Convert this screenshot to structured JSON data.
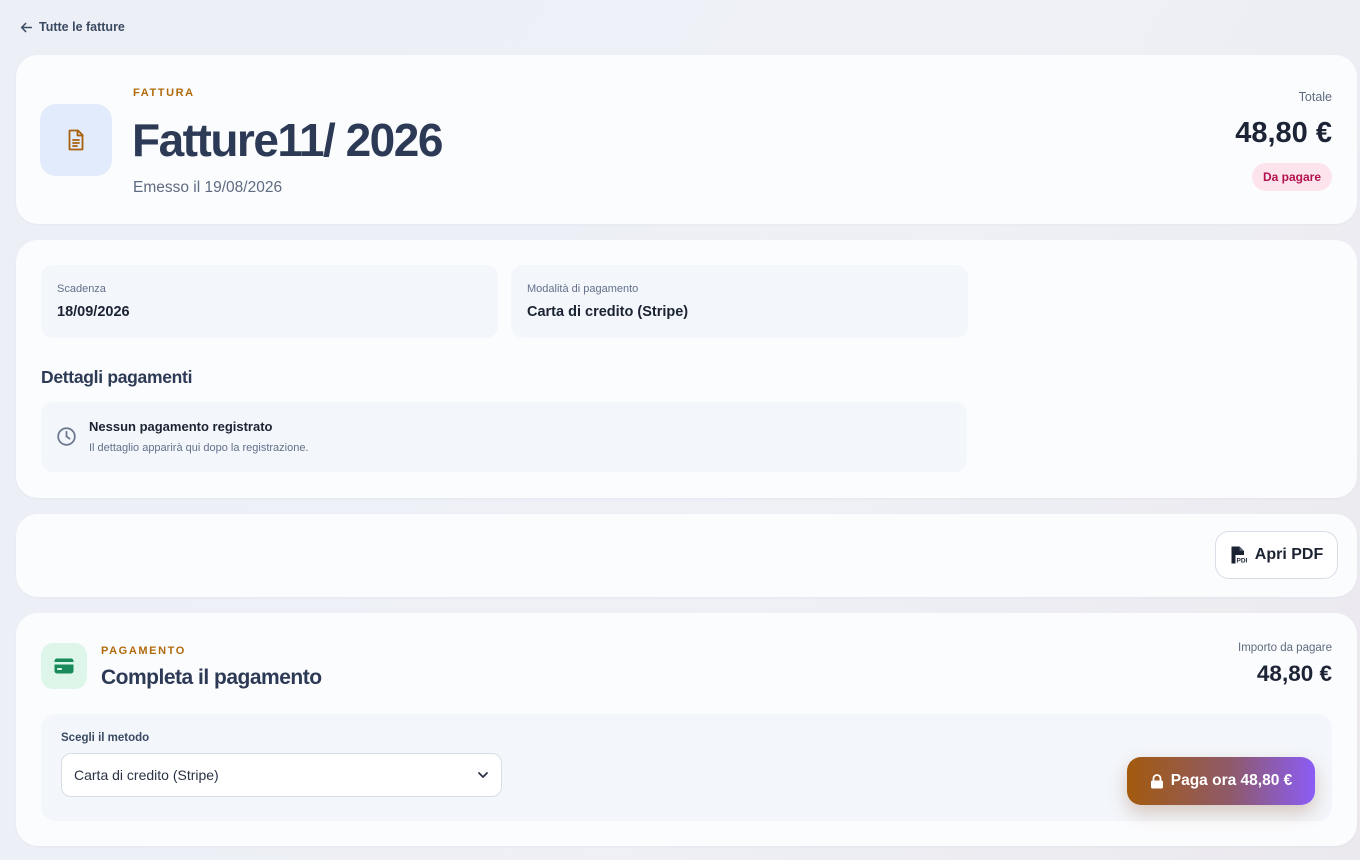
{
  "nav": {
    "back_label": "Tutte le fatture"
  },
  "invoice": {
    "eyebrow": "FATTURA",
    "title": "Fatture11/ 2026",
    "issued": "Emesso il 19/08/2026",
    "total_label": "Totale",
    "total_amount": "48,80 €",
    "status": "Da pagare"
  },
  "details": {
    "due_label": "Scadenza",
    "due_value": "18/09/2026",
    "method_label": "Modalità di pagamento",
    "method_value": "Carta di credito (Stripe)",
    "payments_title": "Dettagli pagamenti",
    "empty_title": "Nessun pagamento registrato",
    "empty_text": "Il dettaglio apparirà qui dopo la registrazione."
  },
  "actions": {
    "pdf_label": "Apri PDF"
  },
  "payment": {
    "eyebrow": "PAGAMENTO",
    "title": "Completa il pagamento",
    "amount_label": "Importo da pagare",
    "amount": "48,80 €",
    "method_label": "Scegli il metodo",
    "method_selected": "Carta di credito (Stripe)",
    "pay_label": "Paga ora 48,80 €"
  },
  "icons": {
    "back": "arrow-left-icon",
    "document": "document-icon",
    "clock": "clock-icon",
    "pdf": "pdf-file-icon",
    "credit_card": "credit-card-icon",
    "chevron": "chevron-down-icon",
    "lock": "lock-icon"
  },
  "colors": {
    "accent_eyebrow": "#b06a0c",
    "status_badge_bg": "#fde3ec",
    "status_badge_text": "#b3124e",
    "pay_gradient_start": "#a35a0e",
    "pay_gradient_end": "#8b5cf6"
  }
}
